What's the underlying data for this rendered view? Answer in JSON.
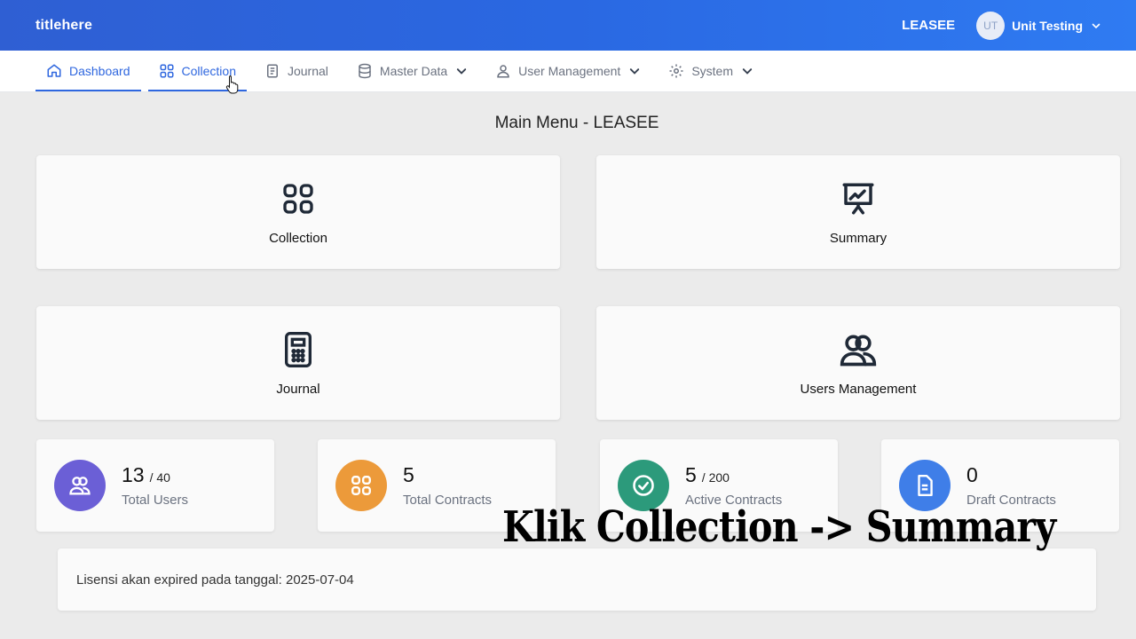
{
  "header": {
    "brand": "titlehere",
    "tenant": "LEASEE",
    "user": {
      "initials": "UT",
      "name": "Unit Testing"
    }
  },
  "nav": {
    "items": [
      {
        "label": "Dashboard",
        "icon": "home-icon"
      },
      {
        "label": "Collection",
        "icon": "grid-icon"
      },
      {
        "label": "Journal",
        "icon": "document-icon"
      },
      {
        "label": "Master Data",
        "icon": "database-icon"
      },
      {
        "label": "User Management",
        "icon": "users-icon"
      },
      {
        "label": "System",
        "icon": "gear-icon"
      }
    ]
  },
  "main": {
    "title": "Main Menu - LEASEE",
    "menu_cards": [
      {
        "label": "Collection",
        "icon": "grid-icon"
      },
      {
        "label": "Summary",
        "icon": "presentation-chart-icon"
      },
      {
        "label": "Journal",
        "icon": "calculator-icon"
      },
      {
        "label": "Users Management",
        "icon": "users-icon"
      }
    ],
    "stats": [
      {
        "value": "13",
        "max": "/ 40",
        "label": "Total Users",
        "color": "#6b5fd6",
        "icon": "users-icon"
      },
      {
        "value": "5",
        "max": "",
        "label": "Total Contracts",
        "color": "#ec9a3a",
        "icon": "grid-icon"
      },
      {
        "value": "5",
        "max": "/ 200",
        "label": "Active Contracts",
        "color": "#2c9a7b",
        "icon": "check-circle-icon"
      },
      {
        "value": "0",
        "max": "",
        "label": "Draft Contracts",
        "color": "#3f7ee8",
        "icon": "document-icon"
      }
    ],
    "license_text": "Lisensi akan expired pada tanggal: 2025-07-04"
  },
  "overlay": {
    "caption": "Klik Collection -> Summary"
  },
  "colors": {
    "accent": "#2f67df",
    "header_start": "#2f5fd3",
    "header_end": "#2f7bf2"
  }
}
